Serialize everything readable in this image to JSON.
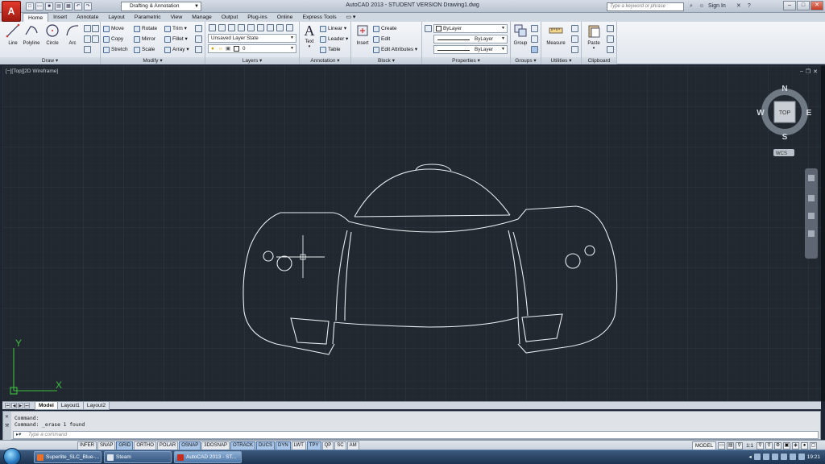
{
  "titlebar": {
    "workspace": "Drafting & Annotation",
    "title": "AutoCAD 2013 - STUDENT VERSION    Drawing1.dwg",
    "search_placeholder": "Type a keyword or phrase",
    "sign_in": "Sign In"
  },
  "ribbon_tabs": [
    "Home",
    "Insert",
    "Annotate",
    "Layout",
    "Parametric",
    "View",
    "Manage",
    "Output",
    "Plug-ins",
    "Online",
    "Express Tools"
  ],
  "panels": {
    "draw": {
      "label": "Draw",
      "line": "Line",
      "polyline": "Polyline",
      "circle": "Circle",
      "arc": "Arc"
    },
    "modify": {
      "label": "Modify",
      "move": "Move",
      "rotate": "Rotate",
      "trim": "Trim",
      "copy": "Copy",
      "mirror": "Mirror",
      "fillet": "Fillet",
      "stretch": "Stretch",
      "scale": "Scale",
      "array": "Array"
    },
    "layers": {
      "label": "Layers",
      "layer_state": "Unsaved Layer State",
      "current_layer": "0"
    },
    "annotation": {
      "label": "Annotation",
      "text": "Text",
      "linear": "Linear",
      "leader": "Leader",
      "table": "Table"
    },
    "block": {
      "label": "Block",
      "insert": "Insert",
      "create": "Create",
      "edit": "Edit",
      "edit_attributes": "Edit Attributes"
    },
    "properties": {
      "label": "Properties",
      "color": "ByLayer",
      "linetype": "ByLayer",
      "lineweight": "ByLayer"
    },
    "groups": {
      "label": "Groups",
      "group": "Group"
    },
    "utilities": {
      "label": "Utilities",
      "measure": "Measure"
    },
    "clipboard": {
      "label": "Clipboard",
      "paste": "Paste"
    }
  },
  "viewport": {
    "label": "[−][Top][2D Wireframe]",
    "viewcube": {
      "top": "TOP",
      "n": "N",
      "s": "S",
      "e": "E",
      "w": "W",
      "wcs": "WCS"
    },
    "ucs": {
      "x": "X",
      "y": "Y"
    }
  },
  "layout_tabs": [
    "Model",
    "Layout1",
    "Layout2"
  ],
  "command": {
    "history": [
      "Command:",
      "Command: _erase 1 found"
    ],
    "placeholder": "Type a command"
  },
  "status": {
    "coords": "",
    "toggles": [
      {
        "label": "INFER",
        "on": false
      },
      {
        "label": "SNAP",
        "on": false
      },
      {
        "label": "GRID",
        "on": true
      },
      {
        "label": "ORTHO",
        "on": false
      },
      {
        "label": "POLAR",
        "on": false
      },
      {
        "label": "OSNAP",
        "on": true
      },
      {
        "label": "3DOSNAP",
        "on": false
      },
      {
        "label": "OTRACK",
        "on": true
      },
      {
        "label": "DUCS",
        "on": true
      },
      {
        "label": "DYN",
        "on": true
      },
      {
        "label": "LWT",
        "on": false
      },
      {
        "label": "TPY",
        "on": true
      },
      {
        "label": "QP",
        "on": false
      },
      {
        "label": "SC",
        "on": false
      },
      {
        "label": "AM",
        "on": false
      }
    ],
    "model": "MODEL",
    "scale": "1:1"
  },
  "taskbar": {
    "items": [
      "Superlite_SLC_Blue-...",
      "Steam",
      "AutoCAD 2013 - ST..."
    ],
    "clock": "19:21"
  },
  "colors": {
    "canvas": "#212830",
    "grid_minor": "#2a323c",
    "grid_major": "#323c48",
    "drawing": "#e8ecf0",
    "ucs": "#3fbf3f"
  }
}
